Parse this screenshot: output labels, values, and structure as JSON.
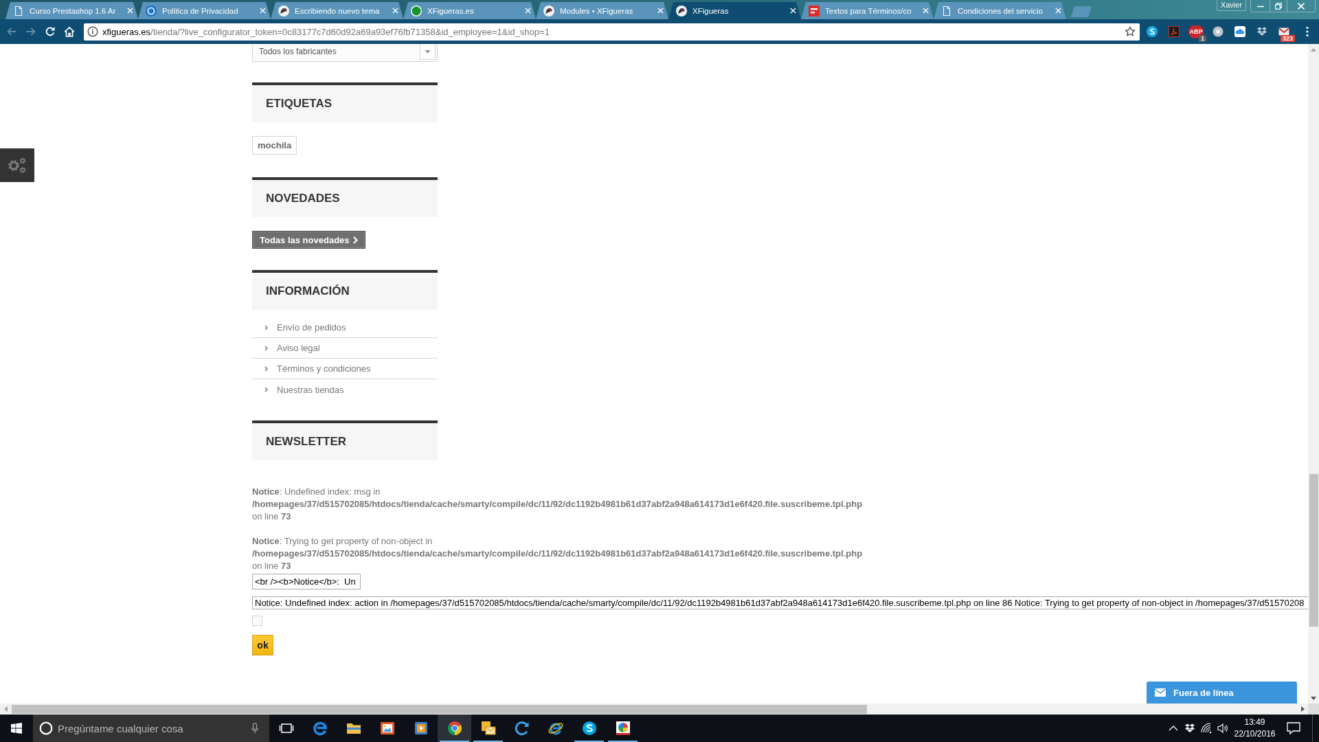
{
  "browser": {
    "tabs": [
      {
        "title": "Curso Prestashop 1.6 Ar",
        "kind": "page",
        "selected": false
      },
      {
        "title": "Política de Privacidad",
        "kind": "ring",
        "selected": false
      },
      {
        "title": "Escribiendo nuevo tema",
        "kind": "bird",
        "selected": false
      },
      {
        "title": "XFigueras.es",
        "kind": "disc",
        "selected": false
      },
      {
        "title": "Modules • XFigueras",
        "kind": "bird",
        "selected": false
      },
      {
        "title": "XFigueras",
        "kind": "bird",
        "selected": true
      },
      {
        "title": "Textos para Términos/co",
        "kind": "block",
        "selected": false
      },
      {
        "title": "Condiciones del servicio",
        "kind": "page",
        "selected": false
      }
    ],
    "profile": "Xavier",
    "navigation": {
      "back_disabled": true,
      "forward_disabled": true
    },
    "address": {
      "host": "xfigueras.es",
      "path": "/tienda/?live_configurator_token=0c83177c7d60d92a69a93ef76fb71358&id_employee=1&id_shop=1"
    },
    "extensions": [
      {
        "kind": "messenger"
      },
      {
        "kind": "document"
      },
      {
        "kind": "blocker",
        "label": "ABP",
        "badge": "1"
      },
      {
        "kind": "disc"
      },
      {
        "kind": "cloud"
      },
      {
        "kind": "box"
      },
      {
        "kind": "mail",
        "badge": "323"
      }
    ]
  },
  "page": {
    "manufacturer_select": {
      "value": "Todos los fabricantes"
    },
    "blocks": [
      {
        "kind": "tags",
        "title": "ETIQUETAS",
        "tags": [
          "mochila"
        ]
      },
      {
        "kind": "button",
        "title": "NOVEDADES",
        "button": "Todas las novedades"
      },
      {
        "kind": "links",
        "title": "INFORMACIÓN",
        "links": [
          "Envío de pedidos",
          "Aviso legal",
          "Términos y condiciones",
          "Nuestras tiendas"
        ]
      },
      {
        "kind": "newsletter",
        "title": "NEWSLETTER",
        "notices": [
          "**Notice**: Undefined index: msg in **/homepages/37/d515702085/htdocs/tienda/cache/smarty/compile/dc/11/92/dc1192b4981b61d37abf2a948a614173d1e6f420.file.suscribeme.tpl.php** on line **73**",
          "**Notice**: Trying to get property of non-object in **/homepages/37/d515702085/htdocs/tienda/cache/smarty/compile/dc/11/92/dc1192b4981b61d37abf2a948a614173d1e6f420.file.suscribeme.tpl.php** on line **73**"
        ],
        "fields": [
          {
            "value": "<br /><b>Notice</b>:  Un"
          },
          {
            "value": "Notice: Undefined index: action in /homepages/37/d515702085/htdocs/tienda/cache/smarty/compile/dc/11/92/dc1192b4981b61d37abf2a948a614173d1e6f420.file.suscribeme.tpl.php on line 86 Notice: Trying to get property of non-object in /homepages/37/d51570208"
          }
        ],
        "checkbox": {
          "checked": false
        },
        "submit": "ok"
      }
    ]
  },
  "chat_widget": {
    "label": "Fuera de línea"
  },
  "taskbar": {
    "search": {
      "placeholder": "Pregúntame cualquier cosa"
    },
    "apps": [
      {
        "kind": "edge",
        "selected": false,
        "running": false
      },
      {
        "kind": "folder",
        "selected": false,
        "running": false
      },
      {
        "kind": "photos",
        "selected": false,
        "running": false
      },
      {
        "kind": "player",
        "selected": false,
        "running": false
      },
      {
        "kind": "chrome",
        "selected": true,
        "running": true
      },
      {
        "kind": "mail",
        "selected": false,
        "running": true
      },
      {
        "kind": "sync",
        "selected": false,
        "running": false
      },
      {
        "kind": "iexplore",
        "selected": false,
        "running": false
      },
      {
        "kind": "messenger",
        "selected": false,
        "running": true
      },
      {
        "kind": "paint",
        "selected": false,
        "running": true
      }
    ],
    "clock": {
      "time": "13:49",
      "date": "22/10/2016"
    }
  }
}
